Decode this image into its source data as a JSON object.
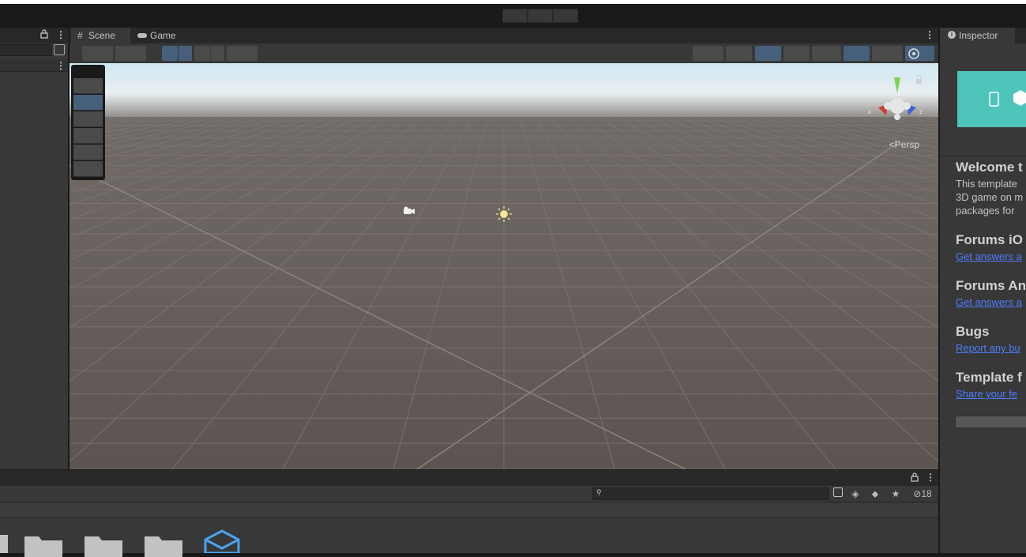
{
  "toolbar": {
    "play_icon": "play-icon",
    "pause_icon": "pause-icon",
    "step_icon": "step-icon"
  },
  "hierarchy": {
    "lock_icon": "lock-icon",
    "menu_icon": "menu-icon"
  },
  "scene": {
    "tabs": [
      {
        "label": "Scene",
        "icon": "hash-icon",
        "active": true
      },
      {
        "label": "Game",
        "icon": "gamepad-icon",
        "active": false
      }
    ],
    "view_mode": "Persp",
    "axis_labels": {
      "x": "x",
      "z": "z"
    }
  },
  "inspector": {
    "tab_label": "Inspector",
    "sections": [
      {
        "title": "Welcome t",
        "desc": [
          "This template",
          "3D game on m",
          "packages for"
        ]
      },
      {
        "title": "Forums iO",
        "link": "Get answers a"
      },
      {
        "title": "Forums An",
        "link": "Get answers a"
      },
      {
        "title": "Bugs",
        "link": "Report any bu"
      },
      {
        "title": "Template f",
        "link": "Share your fe"
      }
    ]
  },
  "project": {
    "hidden_count": "18",
    "search_placeholder": ""
  },
  "colors": {
    "toolbar_bg": "#191919",
    "panel_bg": "#383838",
    "selected_blue": "#46607c",
    "link_blue": "#4c7eff",
    "banner_teal": "#4fc4bb"
  }
}
